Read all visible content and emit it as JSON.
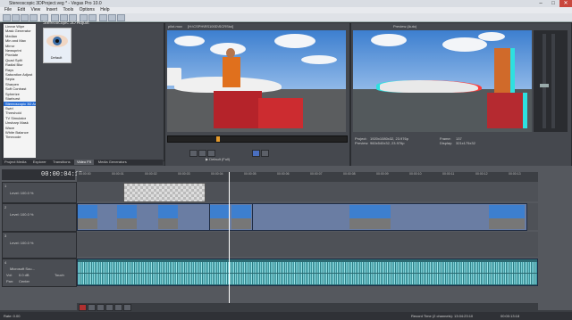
{
  "window": {
    "title": "Stereoscopic 3DProject.veg * - Vegas Pro 10.0",
    "controls": [
      "–",
      "□",
      "✕"
    ]
  },
  "menu": [
    "File",
    "Edit",
    "View",
    "Insert",
    "Tools",
    "Options",
    "Help"
  ],
  "fx_panel": {
    "title": "Stereoscopic 3D Adjust",
    "items": [
      "Linear Wipe",
      "Mask Generator",
      "Median",
      "Min and Max",
      "Mirror",
      "Newsprint",
      "Pixelate",
      "Quad Split",
      "Radial Blur",
      "Rays",
      "Saturation Adjust",
      "Sepia",
      "Sharpen",
      "Soft Contrast",
      "Spherize",
      "Starburst",
      "Stereoscopic 3D Adj",
      "Swirl",
      "Threshold",
      "TV Simulator",
      "Unsharp Mask",
      "Wave",
      "White Balance",
      "Timecode"
    ],
    "selected_index": 16,
    "preset_label": "Default"
  },
  "bottom_tabs": [
    "Project Media",
    "Explorer",
    "Transitions",
    "Video FX",
    "Media Generators"
  ],
  "bottom_tabs_active": 3,
  "preview_left": {
    "header": "pilot.mov",
    "header_info": "[H:\\CSPH\\RS100D\\SCRStoi]",
    "sub_label": "▶  Default (Full)"
  },
  "preview_right": {
    "header": "Preview (Auto)",
    "project_label": "Project:",
    "project_value": "1920x1080x32, 23.976p",
    "preview_label": "Preview:",
    "preview_value": "960x540x32, 23.976p",
    "frame_label": "Frame:",
    "frame_value": "137",
    "display_label": "Display:",
    "display_value": "321x175x32"
  },
  "timeline": {
    "timecode": "00:00:04:15",
    "ruler_ticks": [
      "00:00:00",
      "00:00:01",
      "00:00:02",
      "00:00:03",
      "00:00:04",
      "00:00:05",
      "00:00:06",
      "00:00:07",
      "00:00:08",
      "00:00:09",
      "00:00:10",
      "00:00:11",
      "00:00:12",
      "00:00:13"
    ],
    "tracks": [
      {
        "num": "1",
        "level_label": "Level: 100.0 %"
      },
      {
        "num": "2",
        "level_label": "Level: 100.0 %"
      },
      {
        "num": "3",
        "level_label": "Level: 100.0 %"
      },
      {
        "num": "4",
        "vol_label": "Vol:",
        "vol_value": "0.0 dB",
        "pan_label": "Pan:",
        "pan_value": "Center",
        "touch_label": "Touch",
        "name": "Microsoft Sou..."
      }
    ]
  },
  "status": {
    "rate_label": "Rate: 0.00",
    "record_time": "Record Time (2 channels): 13:04:23:10",
    "end_time": "00:00:13:18"
  }
}
